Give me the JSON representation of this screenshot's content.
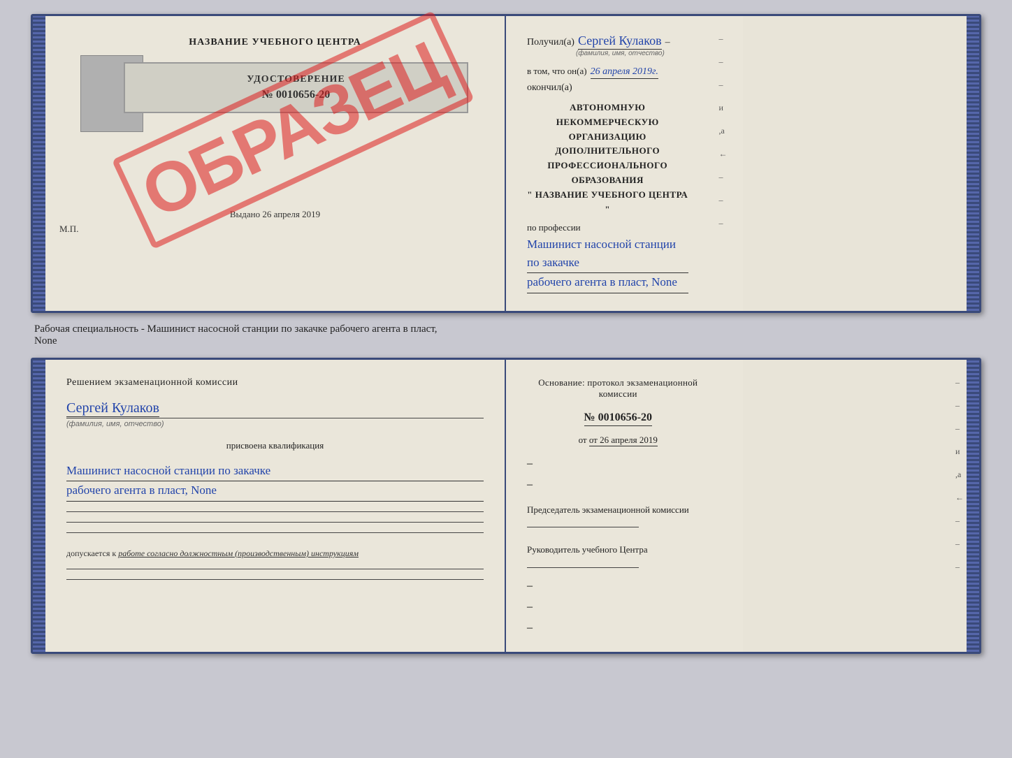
{
  "top_cert": {
    "left": {
      "title": "НАЗВАНИЕ УЧЕБНОГО ЦЕНТРА",
      "stamp": "ОБРАЗЕЦ",
      "udostoverenie": {
        "label": "УДОСТОВЕРЕНИЕ",
        "number": "№ 0010656-20"
      },
      "vydano": "Выдано 26 апреля 2019",
      "mp": "М.П."
    },
    "right": {
      "poluchil_label": "Получил(а)",
      "person_name": "Сергей Кулаков",
      "name_hint": "(фамилия, имя, отчество)",
      "dash": "–",
      "vtom_label": "в том, что он(а)",
      "date": "26 апреля 2019г.",
      "okonchil": "окончил(а)",
      "org_line1": "АВТОНОМНУЮ НЕКОММЕРЧЕСКУЮ ОРГАНИЗАЦИЮ",
      "org_line2": "ДОПОЛНИТЕЛЬНОГО ПРОФЕССИОНАЛЬНОГО ОБРАЗОВАНИЯ",
      "org_line3": "\"    НАЗВАНИЕ УЧЕБНОГО ЦЕНТРА    \"",
      "po_professii": "по профессии",
      "profession_line1": "Машинист насосной станции по закачке",
      "profession_line2": "рабочего агента в пласт, None",
      "dashes": [
        "-",
        "-",
        "-",
        "и",
        ",а",
        "←",
        "-",
        "-",
        "-"
      ]
    }
  },
  "bottom_label": {
    "text": "Рабочая специальность - Машинист насосной станции по закачке рабочего агента в пласт,",
    "text2": "None"
  },
  "bottom_cert": {
    "left": {
      "resheniem": "Решением  экзаменационной  комиссии",
      "person_name": "Сергей Кулаков",
      "name_hint": "(фамилия, имя, отчество)",
      "prisvoena": "присвоена квалификация",
      "profession_line1": "Машинист насосной станции по закачке",
      "profession_line2": "рабочего агента в пласт, None",
      "dopuskaetsya": "допускается к",
      "dopusk_italic": "работе согласно должностным (производственным) инструкциям"
    },
    "right": {
      "osnovanie": "Основание: протокол экзаменационной комиссии",
      "number": "№ 0010656-20",
      "ot": "от 26 апреля 2019",
      "predsedatel_label": "Председатель экзаменационной комиссии",
      "rukovoditel_label": "Руководитель учебного Центра",
      "dashes": [
        "-",
        "-",
        "-",
        "и",
        ",а",
        "←",
        "-",
        "-",
        "-"
      ]
    }
  }
}
